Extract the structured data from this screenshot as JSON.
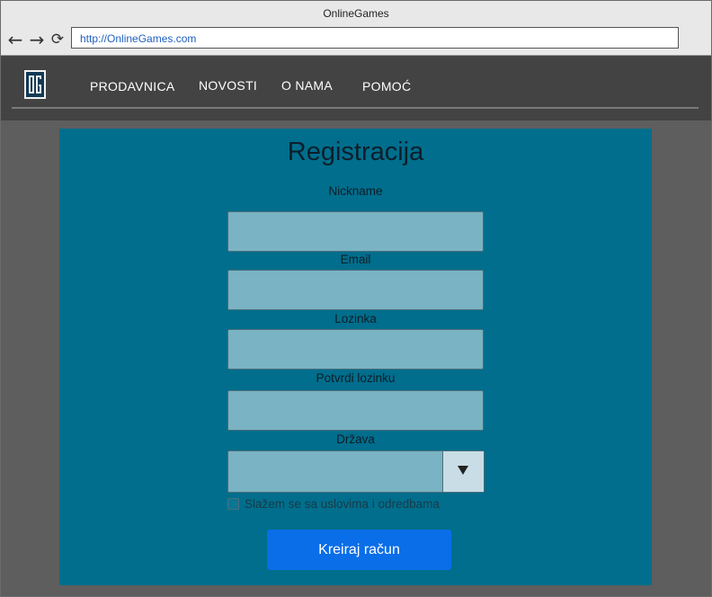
{
  "browser": {
    "window_title": "OnlineGames",
    "url": "http://OnlineGames.com",
    "icons": [
      "back-arrow-icon",
      "forward-arrow-icon",
      "reload-icon"
    ]
  },
  "navbar": {
    "logo_text": "OG",
    "items": [
      {
        "label": "PRODAVNICA"
      },
      {
        "label": "NOVOSTI"
      },
      {
        "label": "O NAMA"
      },
      {
        "label": "POMOĆ"
      }
    ]
  },
  "form": {
    "title": "Registracija",
    "fields": {
      "nickname": {
        "label": "Nickname",
        "value": ""
      },
      "email": {
        "label": "Email",
        "value": ""
      },
      "password": {
        "label": "Lozinka",
        "value": ""
      },
      "confirm_password": {
        "label": "Potvrdi lozinku",
        "value": ""
      },
      "country": {
        "label": "Država",
        "value": ""
      }
    },
    "terms_label": "Slažem se sa uslovima i odredbama",
    "terms_checked": false,
    "submit_label": "Kreiraj račun"
  },
  "colors": {
    "navbar_bg": "#434343",
    "page_bg": "#5e5e5e",
    "panel_bg": "#006e8c",
    "field_bg": "#7ab3c3",
    "button_bg": "#0a6ee8"
  }
}
